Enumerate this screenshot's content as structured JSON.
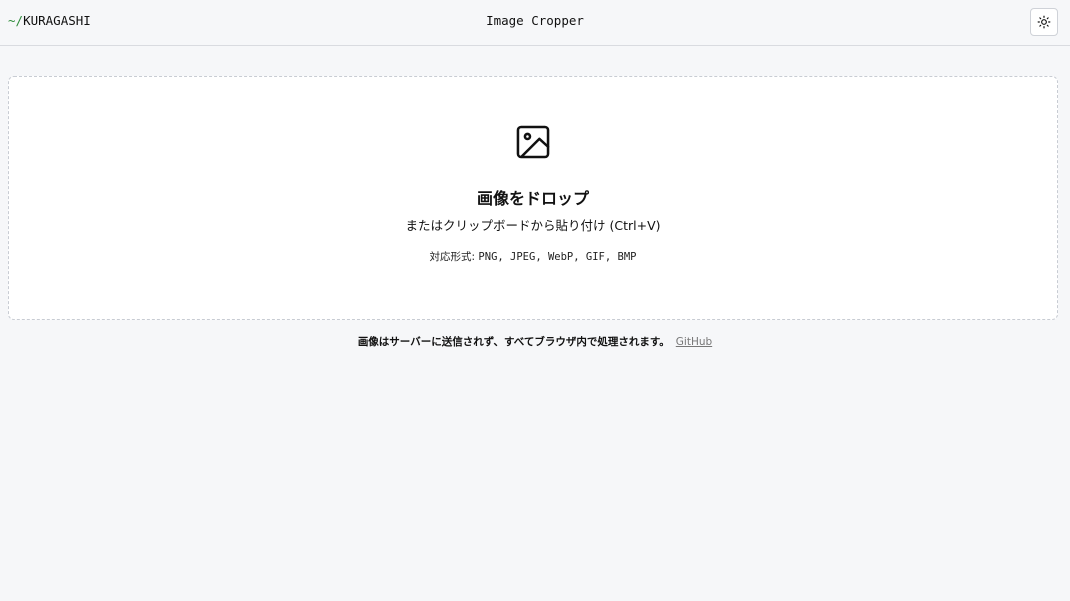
{
  "header": {
    "brand_prefix": "~/",
    "brand_name": "KURAGASHI",
    "title": "Image Cropper",
    "theme_toggle_icon": "sun-icon"
  },
  "dropzone": {
    "icon": "image-icon",
    "title": "画像をドロップ",
    "subtitle": "またはクリップボードから貼り付け (Ctrl+V)",
    "formats_label": "対応形式:",
    "formats_value": "PNG, JPEG, WebP, GIF, BMP"
  },
  "footer": {
    "note": "画像はサーバーに送信されず、すべてブラウザ内で処理されます。",
    "link_label": "GitHub"
  },
  "colors": {
    "background": "#f6f7f9",
    "brand_prefix": "#2e8b3a",
    "link": "#777777"
  }
}
